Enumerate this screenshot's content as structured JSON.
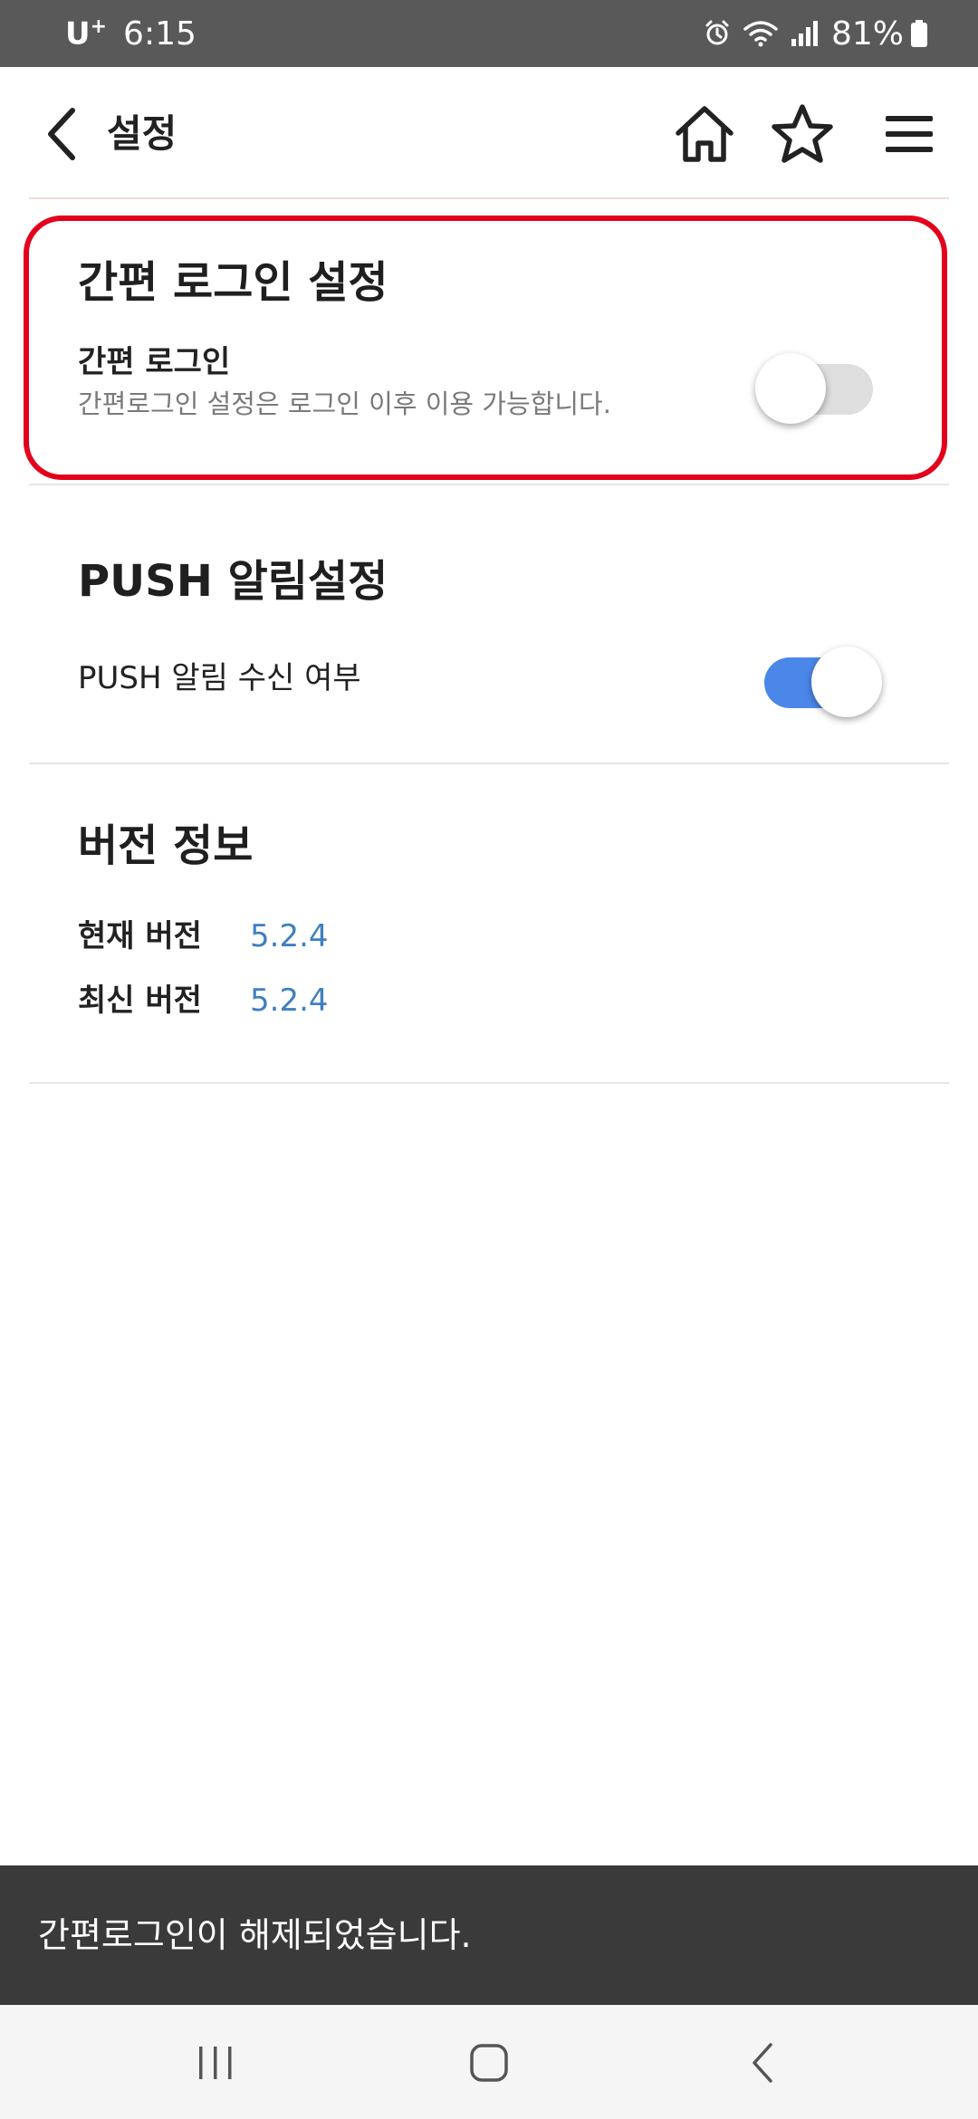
{
  "status_bar": {
    "carrier": "U",
    "carrier_superscript": "+",
    "time": "6:15",
    "battery": "81%",
    "icons": [
      "alarm-icon",
      "wifi-icon",
      "signal-icon",
      "battery-icon"
    ]
  },
  "header": {
    "title": "설정",
    "back_icon": "chevron-left-icon",
    "actions": [
      "home-icon",
      "star-icon",
      "menu-icon"
    ]
  },
  "easy_login": {
    "title": "간편 로그인 설정",
    "label": "간편 로그인",
    "description": "간편로그인 설정은 로그인 이후 이용 가능합니다.",
    "enabled": false,
    "highlight_color": "#e3001b"
  },
  "push": {
    "title": "PUSH 알림설정",
    "label": "PUSH 알림 수신 여부",
    "enabled": true,
    "toggle_color": "#4a87e8"
  },
  "version": {
    "title": "버전 정보",
    "rows": [
      {
        "label": "현재 버전",
        "value": "5.2.4"
      },
      {
        "label": "최신 버전",
        "value": "5.2.4"
      }
    ],
    "value_color": "#3f7fc0"
  },
  "toast": {
    "message": "간편로그인이 해제되었습니다."
  },
  "nav_bar": {
    "buttons": [
      "recents-icon",
      "home-circle-icon",
      "back-icon"
    ]
  }
}
